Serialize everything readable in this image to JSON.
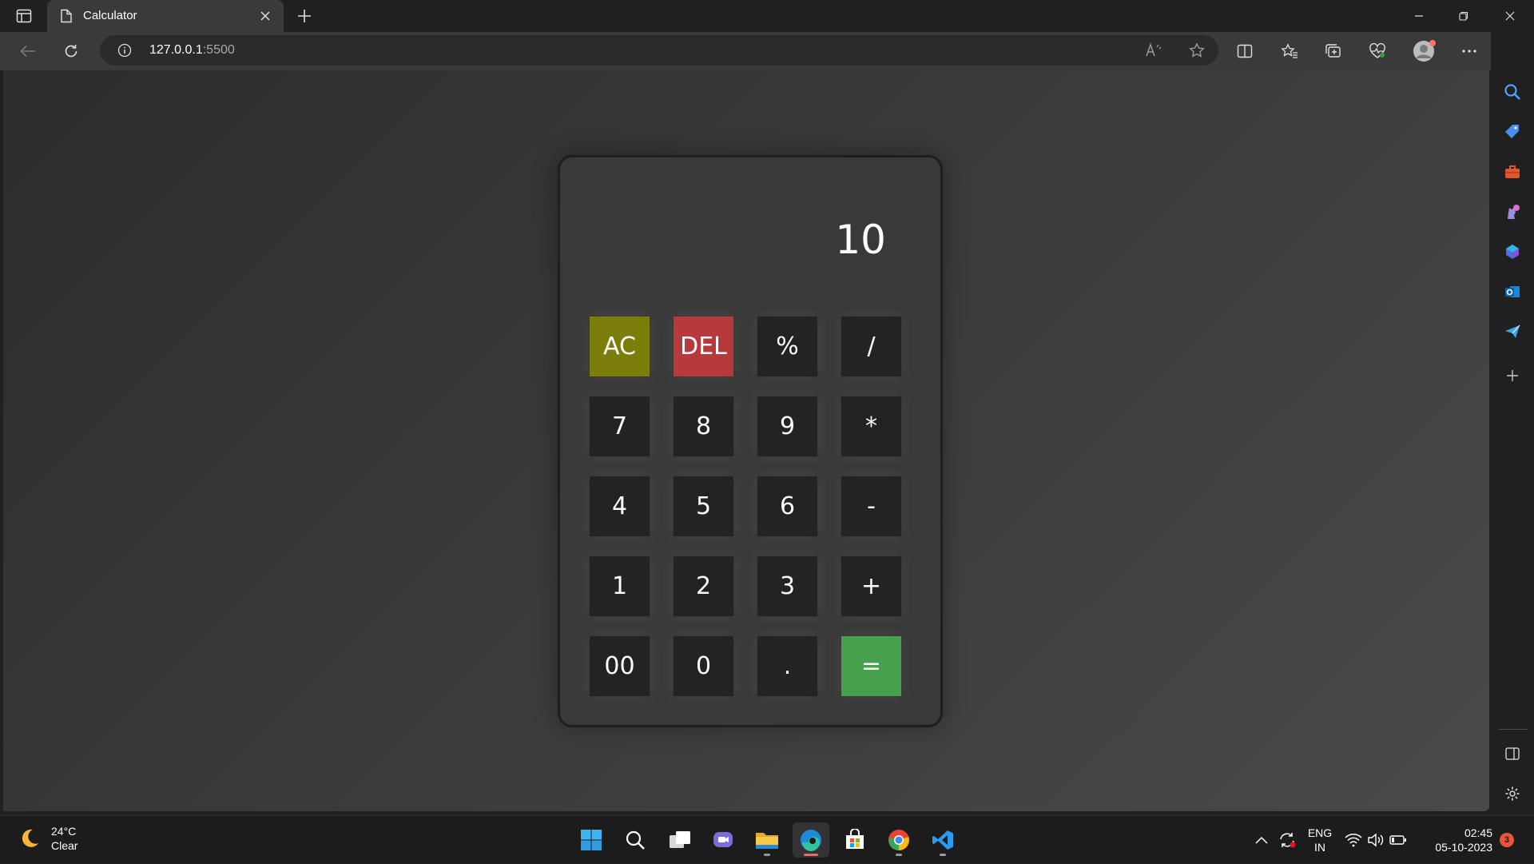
{
  "browser": {
    "tab": {
      "title": "Calculator"
    },
    "address": {
      "host": "127.0.0.1",
      "port": ":5500"
    }
  },
  "calculator": {
    "display": "10",
    "keys": [
      "AC",
      "DEL",
      "%",
      "/",
      "7",
      "8",
      "9",
      "*",
      "4",
      "5",
      "6",
      "-",
      "1",
      "2",
      "3",
      "+",
      "00",
      "0",
      ".",
      "="
    ],
    "colors": {
      "ac": "#7c7e0c",
      "del": "#b8393b",
      "equals": "#46a04d",
      "key": "#232323"
    }
  },
  "taskbar": {
    "weather": {
      "temp": "24°C",
      "condition": "Clear"
    },
    "language": {
      "line1": "ENG",
      "line2": "IN"
    },
    "clock": {
      "time": "02:45",
      "date": "05-10-2023"
    },
    "notifications": "3"
  }
}
